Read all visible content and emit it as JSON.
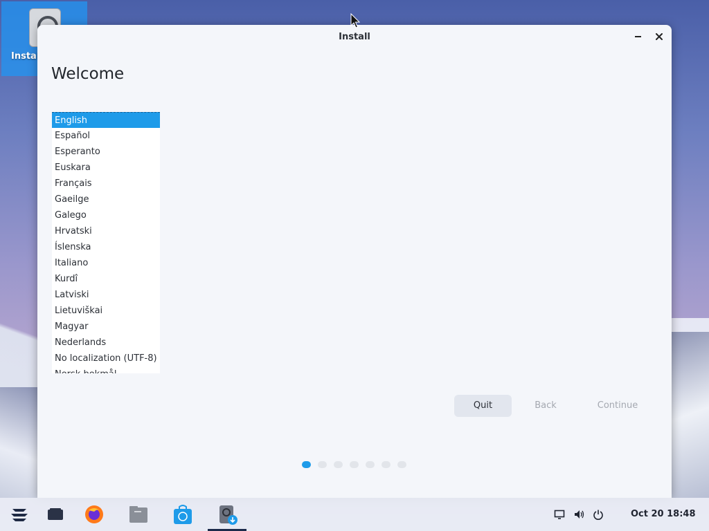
{
  "desktop": {
    "icon_label": "Install"
  },
  "window": {
    "title": "Install",
    "heading": "Welcome",
    "languages": [
      "English",
      "Español",
      "Esperanto",
      "Euskara",
      "Français",
      "Gaeilge",
      "Galego",
      "Hrvatski",
      "Íslenska",
      "Italiano",
      "Kurdî",
      "Latviski",
      "Lietuviškai",
      "Magyar",
      "Nederlands",
      "No localization (UTF-8)",
      "Norsk bokmål"
    ],
    "selected_language": "English",
    "buttons": {
      "quit": "Quit",
      "back": "Back",
      "continue": "Continue"
    },
    "progress": {
      "current_step": 1,
      "total_steps": 7
    }
  },
  "taskbar": {
    "apps": [
      "zorin-menu-icon",
      "workspaces-icon",
      "firefox-icon",
      "files-icon",
      "software-icon",
      "installer-icon"
    ],
    "clock": "Oct 20  18:48"
  },
  "colors": {
    "accent": "#1e9be9",
    "window_bg": "#f4f6fa"
  }
}
